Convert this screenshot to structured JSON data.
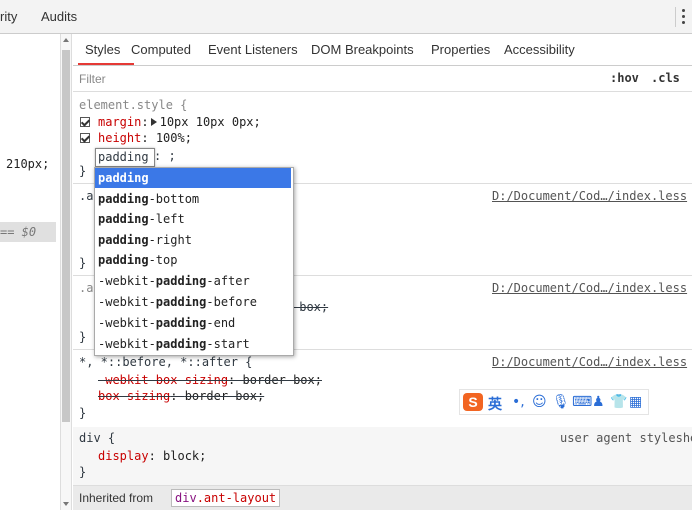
{
  "topbar": {
    "tabs": [
      "rity",
      "Audits"
    ],
    "menu_icon": "vertical-dots-icon"
  },
  "elements_pane": {
    "value_text": "210px;",
    "selected_marker": "== $0"
  },
  "styles_pane": {
    "tabs": [
      "Styles",
      "Computed",
      "Event Listeners",
      "DOM Breakpoints",
      "Properties",
      "Accessibility"
    ],
    "active_tab": "Styles",
    "filter_placeholder": "Filter",
    "hov_label": ":hov",
    "cls_label": ".cls",
    "element_style": {
      "selector": "element.style {",
      "rules": [
        {
          "prop": "margin",
          "value": "10px 10px 0px;"
        },
        {
          "prop": "height",
          "value": "100%;"
        }
      ],
      "editing_text": "padding",
      "editing_rest": ": ;",
      "close": "}"
    },
    "rule2": {
      "selector_prefix": ".a",
      "source": "D:/Document/Cod…/index.less",
      "close": "}"
    },
    "rule3": {
      "selector_prefix": ".a",
      "strike_tail": "-box;",
      "source": "D:/Document/Cod…/index.less",
      "close": "}"
    },
    "rule4": {
      "selector": "*, *::before, *::after {",
      "source": "D:/Document/Cod…/index.less",
      "lines": [
        {
          "prop": "-webkit-box-sizing",
          "value": "border-box;"
        },
        {
          "prop": "box-sizing",
          "value": "border-box;"
        }
      ],
      "close": "}"
    },
    "ua_rule": {
      "selector": "div {",
      "source": "user agent stylesheet",
      "prop": "display",
      "value": "block;",
      "close": "}"
    },
    "inherited": {
      "label": "Inherited from",
      "tag": "div",
      "cls": ".ant-layout"
    }
  },
  "autocomplete": {
    "items": [
      {
        "pre": "",
        "match": "padding",
        "post": "",
        "highlighted": true
      },
      {
        "pre": "",
        "match": "padding",
        "post": "-bottom"
      },
      {
        "pre": "",
        "match": "padding",
        "post": "-left"
      },
      {
        "pre": "",
        "match": "padding",
        "post": "-right"
      },
      {
        "pre": "",
        "match": "padding",
        "post": "-top"
      },
      {
        "pre": "-webkit-",
        "match": "padding",
        "post": "-after"
      },
      {
        "pre": "-webkit-",
        "match": "padding",
        "post": "-before"
      },
      {
        "pre": "-webkit-",
        "match": "padding",
        "post": "-end"
      },
      {
        "pre": "-webkit-",
        "match": "padding",
        "post": "-start"
      }
    ]
  },
  "ime_toolbar": {
    "logo": "S",
    "lang": "英",
    "icons": [
      "punctuation-icon",
      "emoji-icon",
      "microphone-icon",
      "keyboard-icon",
      "person-icon",
      "shirt-icon",
      "grid-icon"
    ],
    "glyphs": [
      "•,",
      "☺",
      "🎙",
      "⌨",
      "♟",
      "👕",
      "▦"
    ],
    "accent": "#f26522"
  }
}
